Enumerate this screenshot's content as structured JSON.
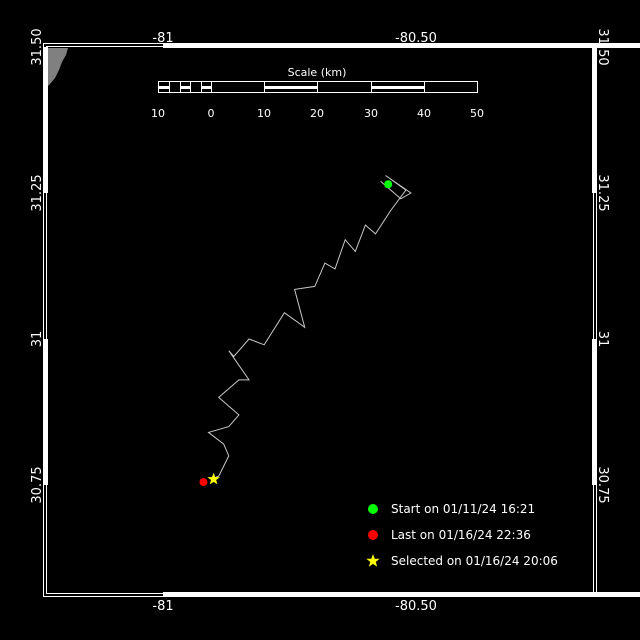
{
  "map": {
    "lon_range": [
      -81.2,
      -80.3
    ],
    "lat_range": [
      30.62,
      31.5
    ],
    "lon_tick_labels": [
      {
        "value": -81.0,
        "label": "-81"
      },
      {
        "value": -80.5,
        "label": "-80.50"
      }
    ],
    "lat_tick_labels": [
      {
        "value": 31.5,
        "label": "31.50"
      },
      {
        "value": 31.25,
        "label": "31.25"
      },
      {
        "value": 31.0,
        "label": "31"
      },
      {
        "value": 30.75,
        "label": "30.75"
      }
    ],
    "scale": {
      "title": "Scale (km)",
      "labels": [
        "10",
        "0",
        "10",
        "20",
        "30",
        "40",
        "50"
      ]
    },
    "colors": {
      "background": "#000000",
      "track": "#c8c8c8",
      "start": "#00ff00",
      "last": "#ff0000",
      "selected": "#ffff00",
      "land": "#808080"
    },
    "track": [
      {
        "lon": -80.57,
        "lat": 31.27
      },
      {
        "lon": -80.53,
        "lat": 31.24
      },
      {
        "lon": -80.51,
        "lat": 31.25
      },
      {
        "lon": -80.56,
        "lat": 31.28
      },
      {
        "lon": -80.52,
        "lat": 31.255
      },
      {
        "lon": -80.55,
        "lat": 31.22
      },
      {
        "lon": -80.58,
        "lat": 31.18
      },
      {
        "lon": -80.6,
        "lat": 31.195
      },
      {
        "lon": -80.62,
        "lat": 31.15
      },
      {
        "lon": -80.64,
        "lat": 31.17
      },
      {
        "lon": -80.66,
        "lat": 31.12
      },
      {
        "lon": -80.68,
        "lat": 31.13
      },
      {
        "lon": -80.7,
        "lat": 31.09
      },
      {
        "lon": -80.74,
        "lat": 31.085
      },
      {
        "lon": -80.72,
        "lat": 31.02
      },
      {
        "lon": -80.76,
        "lat": 31.045
      },
      {
        "lon": -80.8,
        "lat": 30.99
      },
      {
        "lon": -80.83,
        "lat": 31.0
      },
      {
        "lon": -80.86,
        "lat": 30.97
      },
      {
        "lon": -80.87,
        "lat": 30.98
      },
      {
        "lon": -80.83,
        "lat": 30.93
      },
      {
        "lon": -80.85,
        "lat": 30.93
      },
      {
        "lon": -80.89,
        "lat": 30.9
      },
      {
        "lon": -80.85,
        "lat": 30.87
      },
      {
        "lon": -80.87,
        "lat": 30.85
      },
      {
        "lon": -80.91,
        "lat": 30.84
      },
      {
        "lon": -80.88,
        "lat": 30.82
      },
      {
        "lon": -80.87,
        "lat": 30.8
      },
      {
        "lon": -80.89,
        "lat": 30.765
      },
      {
        "lon": -80.905,
        "lat": 30.76
      }
    ],
    "start": {
      "lon": -80.555,
      "lat": 31.265
    },
    "last": {
      "lon": -80.92,
      "lat": 30.755
    },
    "selected": {
      "lon": -80.9,
      "lat": 30.76
    },
    "legend": [
      {
        "marker": "start",
        "text": "Start on 01/11/24 16:21"
      },
      {
        "marker": "last",
        "text": "Last on 01/16/24 22:36"
      },
      {
        "marker": "selected",
        "text": "Selected on 01/16/24 20:06"
      }
    ]
  }
}
